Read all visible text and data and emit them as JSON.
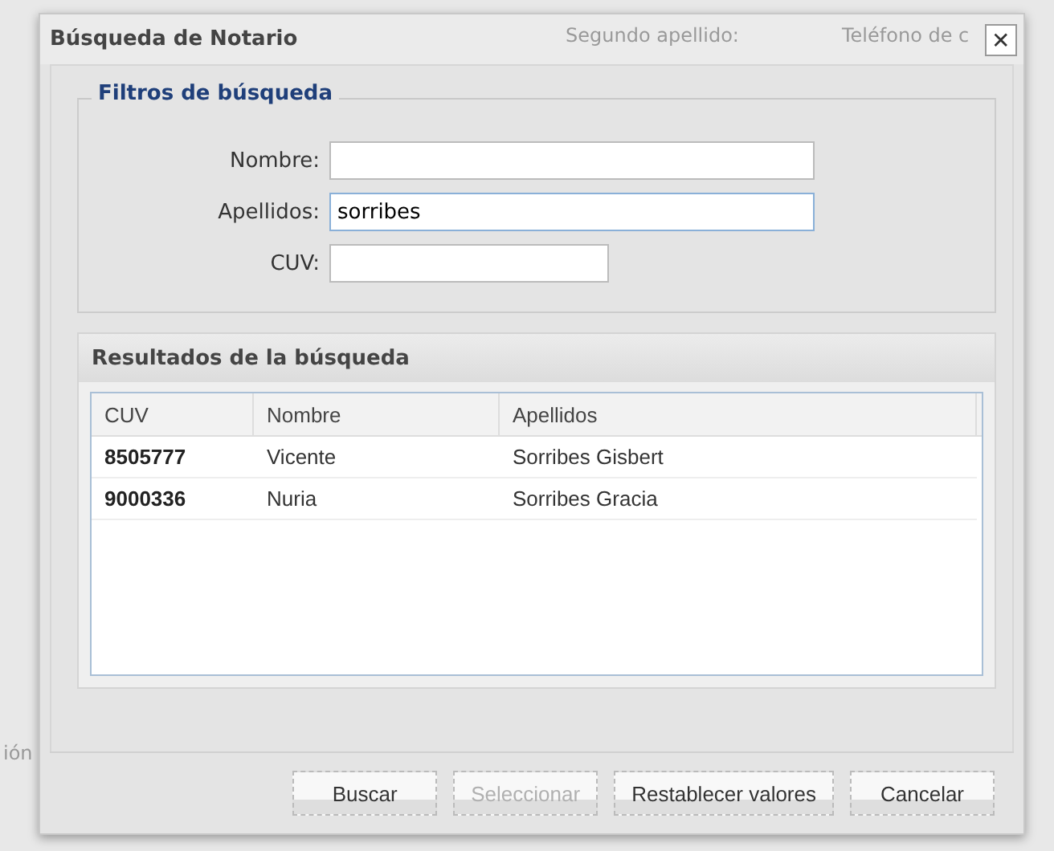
{
  "background": {
    "texts": [
      "Segundo apellido:",
      "Teléfono de c",
      "ión"
    ]
  },
  "dialog": {
    "title": "Búsqueda de Notario",
    "close": "✕"
  },
  "filters": {
    "legend": "Filtros de búsqueda",
    "fields": [
      {
        "label": "Nombre:",
        "focused": false,
        "kind": "wide"
      },
      {
        "label": "Apellidos:",
        "value": "sorribes",
        "focused": true,
        "kind": "wide"
      },
      {
        "label": "CUV:",
        "focused": false,
        "kind": "narrow"
      }
    ]
  },
  "results": {
    "title": "Resultados de la búsqueda",
    "columns": [
      "CUV",
      "Nombre",
      "Apellidos"
    ],
    "rows": [
      {
        "cells": [
          "8505777",
          "Vicente",
          "Sorribes Gisbert"
        ],
        "selected": false
      },
      {
        "cells": [
          "9000336",
          "Nuria",
          "Sorribes Gracia"
        ],
        "selected": false
      }
    ]
  },
  "buttons": [
    {
      "label": "Buscar",
      "disabled": false
    },
    {
      "label": "Seleccionar",
      "disabled": true
    },
    {
      "label": "Restablecer valores",
      "disabled": false
    },
    {
      "label": "Cancelar",
      "disabled": false
    }
  ]
}
